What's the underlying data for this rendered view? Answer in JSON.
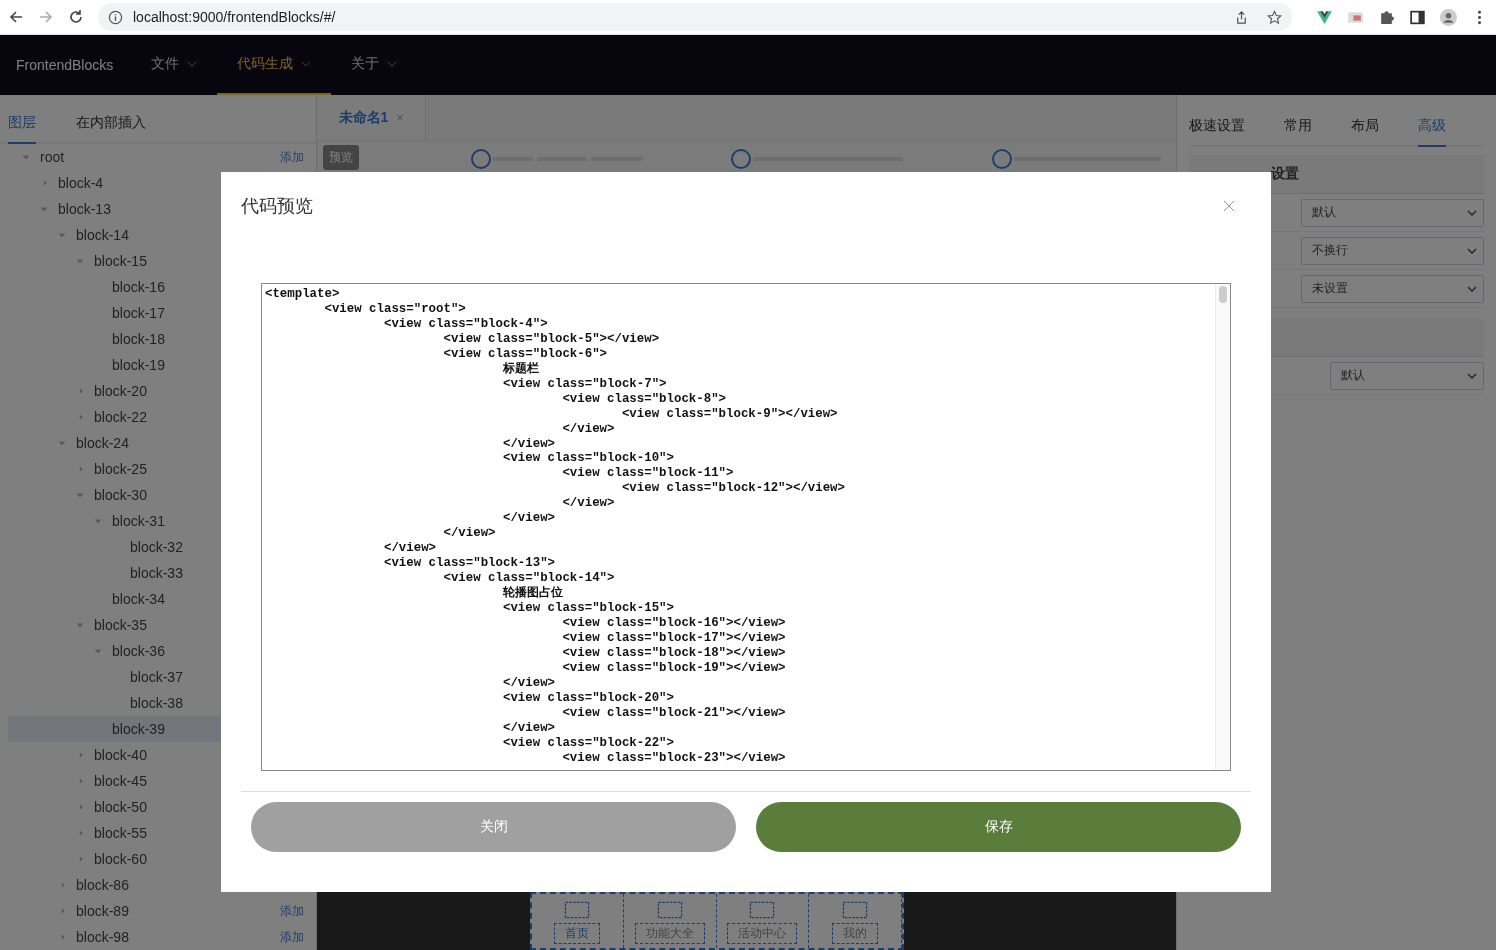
{
  "browser": {
    "url": "localhost:9000/frontendBlocks/#/"
  },
  "nav": {
    "brand": "FrontendBlocks",
    "menus": [
      {
        "label": "文件",
        "selected": false
      },
      {
        "label": "代码生成",
        "selected": true
      },
      {
        "label": "关于",
        "selected": false
      }
    ]
  },
  "left_panel": {
    "tabs": [
      {
        "label": "图层",
        "selected": true
      },
      {
        "label": "在内部插入",
        "selected": false
      }
    ],
    "tree": [
      {
        "label": "root",
        "expanded": true,
        "selected": false,
        "action": "添加",
        "children": [
          {
            "label": "block-4",
            "expanded": false,
            "selected": false
          },
          {
            "label": "block-13",
            "expanded": true,
            "selected": false,
            "children": [
              {
                "label": "block-14",
                "expanded": true,
                "selected": false,
                "children": [
                  {
                    "label": "block-15",
                    "expanded": true,
                    "selected": false,
                    "children": [
                      {
                        "label": "block-16",
                        "selected": false
                      },
                      {
                        "label": "block-17",
                        "selected": false
                      },
                      {
                        "label": "block-18",
                        "selected": false
                      },
                      {
                        "label": "block-19",
                        "selected": false
                      }
                    ]
                  },
                  {
                    "label": "block-20",
                    "expanded": false,
                    "selected": false
                  },
                  {
                    "label": "block-22",
                    "expanded": false,
                    "selected": false
                  }
                ]
              },
              {
                "label": "block-24",
                "expanded": true,
                "selected": false,
                "children": [
                  {
                    "label": "block-25",
                    "expanded": false,
                    "selected": false
                  },
                  {
                    "label": "block-30",
                    "expanded": true,
                    "selected": false,
                    "children": [
                      {
                        "label": "block-31",
                        "expanded": true,
                        "selected": false,
                        "children": [
                          {
                            "label": "block-32",
                            "selected": false
                          },
                          {
                            "label": "block-33",
                            "selected": false
                          }
                        ]
                      },
                      {
                        "label": "block-34",
                        "selected": false
                      }
                    ]
                  },
                  {
                    "label": "block-35",
                    "expanded": true,
                    "selected": false,
                    "children": [
                      {
                        "label": "block-36",
                        "expanded": true,
                        "selected": false,
                        "children": [
                          {
                            "label": "block-37",
                            "selected": false
                          },
                          {
                            "label": "block-38",
                            "selected": false
                          }
                        ]
                      },
                      {
                        "label": "block-39",
                        "selected": true
                      }
                    ]
                  },
                  {
                    "label": "block-40",
                    "expanded": false,
                    "selected": false
                  },
                  {
                    "label": "block-45",
                    "expanded": false,
                    "selected": false
                  },
                  {
                    "label": "block-50",
                    "expanded": false,
                    "selected": false
                  },
                  {
                    "label": "block-55",
                    "expanded": false,
                    "selected": false
                  },
                  {
                    "label": "block-60",
                    "expanded": false,
                    "selected": false
                  }
                ]
              },
              {
                "label": "block-86",
                "expanded": false,
                "selected": false
              },
              {
                "label": "block-89",
                "expanded": false,
                "selected": false,
                "action": "添加"
              },
              {
                "label": "block-98",
                "expanded": false,
                "selected": false,
                "action": "添加"
              }
            ]
          }
        ]
      }
    ]
  },
  "editor": {
    "tab": {
      "label": "未命名1",
      "close": "×"
    },
    "preview_button": "预览",
    "tabbar": [
      {
        "label": "首页",
        "selected": true
      },
      {
        "label": "功能大全",
        "selected": false
      },
      {
        "label": "活动中心",
        "selected": false
      },
      {
        "label": "我的",
        "selected": false
      }
    ]
  },
  "right_panel": {
    "tabs": [
      {
        "label": "极速设置",
        "selected": false
      },
      {
        "label": "常用",
        "selected": false
      },
      {
        "label": "布局",
        "selected": false
      },
      {
        "label": "高级",
        "selected": true
      }
    ],
    "section_title": "设置",
    "selects": [
      "默认",
      "不换行",
      "未设置"
    ],
    "select_2": "默认"
  },
  "modal": {
    "title": "代码预览",
    "code": [
      "<template>",
      "\t<view class=\"root\">",
      "\t\t<view class=\"block-4\">",
      "\t\t\t<view class=\"block-5\"></view>",
      "\t\t\t<view class=\"block-6\">",
      "\t\t\t\t标题栏",
      "\t\t\t\t<view class=\"block-7\">",
      "\t\t\t\t\t<view class=\"block-8\">",
      "\t\t\t\t\t\t<view class=\"block-9\"></view>",
      "\t\t\t\t\t</view>",
      "\t\t\t\t</view>",
      "\t\t\t\t<view class=\"block-10\">",
      "\t\t\t\t\t<view class=\"block-11\">",
      "\t\t\t\t\t\t<view class=\"block-12\"></view>",
      "\t\t\t\t\t</view>",
      "\t\t\t\t</view>",
      "\t\t\t</view>",
      "\t\t</view>",
      "\t\t<view class=\"block-13\">",
      "\t\t\t<view class=\"block-14\">",
      "\t\t\t\t轮播图占位",
      "\t\t\t\t<view class=\"block-15\">",
      "\t\t\t\t\t<view class=\"block-16\"></view>",
      "\t\t\t\t\t<view class=\"block-17\"></view>",
      "\t\t\t\t\t<view class=\"block-18\"></view>",
      "\t\t\t\t\t<view class=\"block-19\"></view>",
      "\t\t\t\t</view>",
      "\t\t\t\t<view class=\"block-20\">",
      "\t\t\t\t\t<view class=\"block-21\"></view>",
      "\t\t\t\t</view>",
      "\t\t\t\t<view class=\"block-22\">",
      "\t\t\t\t\t<view class=\"block-23\"></view>"
    ],
    "buttons": [
      {
        "label": "关闭",
        "kind": "secondary"
      },
      {
        "label": "保存",
        "kind": "primary"
      }
    ]
  }
}
